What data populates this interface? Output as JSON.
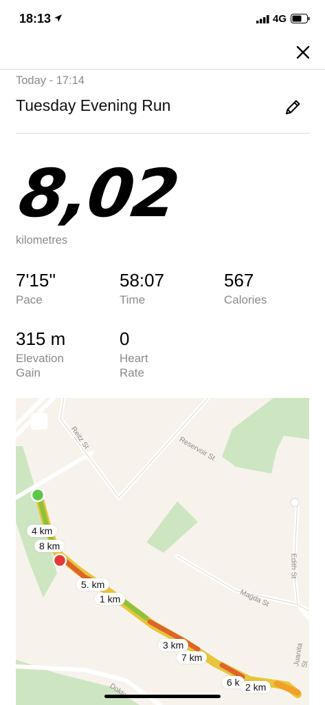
{
  "status_bar": {
    "time": "18:13",
    "network": "4G"
  },
  "header": {
    "date": "Today - 17:14",
    "title": "Tuesday Evening Run"
  },
  "distance": {
    "value": "8,02",
    "unit": "kilometres"
  },
  "stats": [
    {
      "value": "7'15''",
      "label": "Pace"
    },
    {
      "value": "58:07",
      "label": "Time"
    },
    {
      "value": "567",
      "label": "Calories"
    },
    {
      "value": "315 m",
      "label": "Elevation Gain"
    },
    {
      "value": "0",
      "label": "Heart Rate"
    }
  ],
  "map": {
    "streets": [
      "Reitz St",
      "Reservoir St",
      "Edith St",
      "Magda St",
      "Juanita St",
      "Doktor"
    ],
    "km_markers": [
      "4 km",
      "8 km",
      "5. km",
      "1 km",
      "3 km",
      "7 km",
      "6 k",
      "2 km"
    ],
    "start_color": "#5cc84a",
    "end_color": "#e53935"
  }
}
